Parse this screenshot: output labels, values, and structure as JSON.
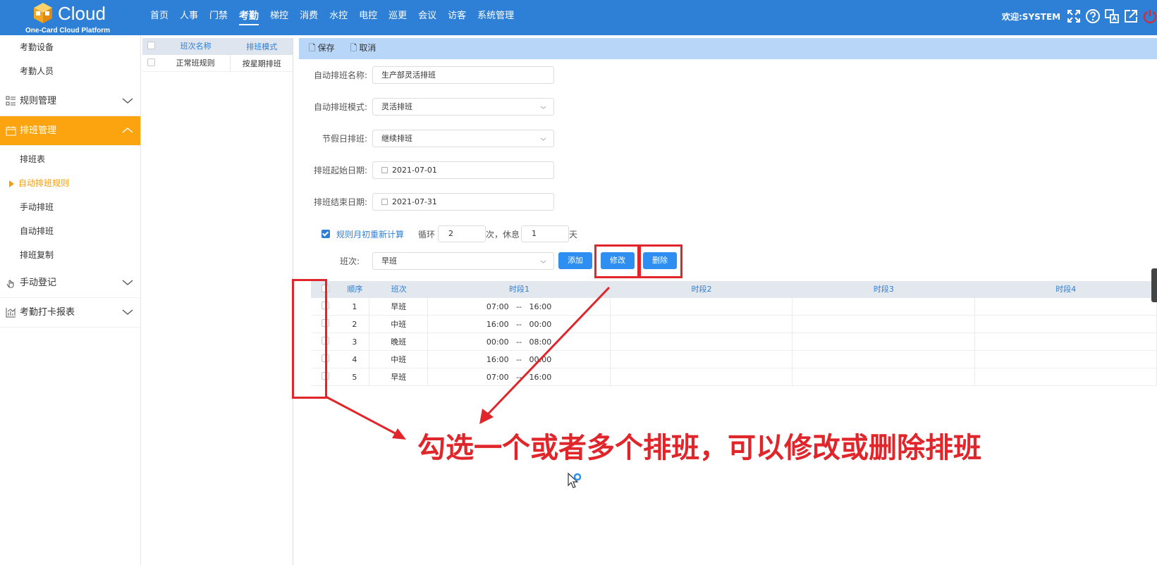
{
  "header": {
    "logo_text": "Cloud",
    "logo_sub": "One-Card Cloud Platform",
    "nav": [
      "首页",
      "人事",
      "门禁",
      "考勤",
      "梯控",
      "消费",
      "水控",
      "电控",
      "巡更",
      "会议",
      "访客",
      "系统管理"
    ],
    "nav_active": "考勤",
    "welcome": "欢迎:SYSTEM",
    "icons": [
      "fullscreen-icon",
      "help-icon",
      "translate-icon",
      "external-link-icon",
      "power-icon"
    ]
  },
  "sidebar": {
    "sub_top": [
      "考勤设备",
      "考勤人员"
    ],
    "groups": {
      "rules": "规则管理",
      "schedule": "排班管理",
      "manual_reg": "手动登记",
      "report": "考勤打卡报表"
    },
    "schedule_items": [
      "排班表",
      "自动排班规则",
      "手动排班",
      "自动排班",
      "排班复制"
    ],
    "active_item": "自动排班规则"
  },
  "midpanel": {
    "headers": [
      "班次名称",
      "排班模式"
    ],
    "rows": [
      {
        "name": "正常班规则",
        "mode": "按星期排班"
      }
    ]
  },
  "toolbar": {
    "save": "保存",
    "cancel": "取消"
  },
  "form": {
    "name_label": "自动排班名称:",
    "name_value": "生产部灵活排班",
    "mode_label": "自动排班模式:",
    "mode_value": "灵活排班",
    "holiday_label": "节假日排班:",
    "holiday_value": "继续排班",
    "start_label": "排班起始日期:",
    "start_value": "2021-07-01",
    "end_label": "排班结束日期:",
    "end_value": "2021-07-31",
    "recalc_label": "规则月初重新计算",
    "cycle_label": "循环",
    "cycle_value": "2",
    "times_rest_label": "次，休息",
    "rest_value": "1",
    "day_label": "天",
    "shift_label": "班次:",
    "shift_value": "早班",
    "add_btn": "添加",
    "edit_btn": "修改",
    "delete_btn": "删除"
  },
  "grid": {
    "headers": [
      "顺序",
      "班次",
      "时段1",
      "时段2",
      "时段3",
      "时段4"
    ],
    "rows": [
      {
        "seq": "1",
        "shift": "早班",
        "p1": "07:00   --   16:00"
      },
      {
        "seq": "2",
        "shift": "中班",
        "p1": "16:00   --   00:00"
      },
      {
        "seq": "3",
        "shift": "晚班",
        "p1": "00:00   --   08:00"
      },
      {
        "seq": "4",
        "shift": "中班",
        "p1": "16:00   --   00:00"
      },
      {
        "seq": "5",
        "shift": "早班",
        "p1": "07:00   --   16:00"
      }
    ]
  },
  "annotation": "勾选一个或者多个排班，可以修改或删除排班",
  "colors": {
    "primary": "#2e7fd6",
    "active_menu": "#fca40f",
    "annotation_red": "#e0262b"
  }
}
